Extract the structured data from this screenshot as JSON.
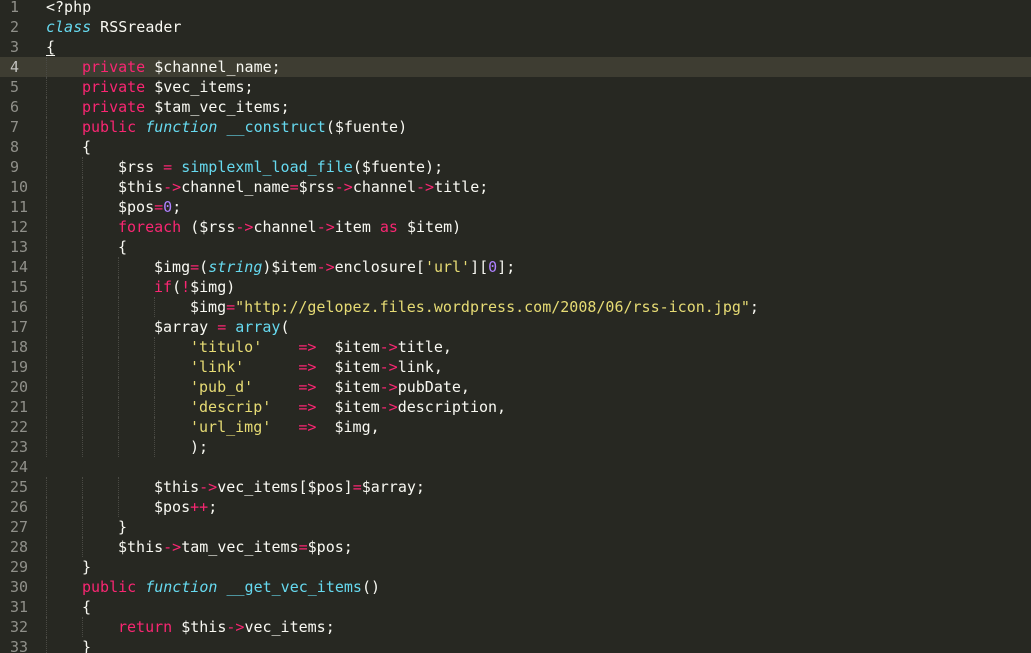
{
  "editor": {
    "colors": {
      "background": "#272822",
      "current_line": "#3e3d32",
      "keyword": "#f92672",
      "storage": "#66d9ef",
      "string": "#e6db74",
      "number": "#ae81ff",
      "plain": "#f8f8f2",
      "gutter_text": "#90908a"
    },
    "current_line_number": 4,
    "lines": [
      {
        "n": "1",
        "indent": 0,
        "tokens": [
          [
            "p",
            "<?php"
          ]
        ]
      },
      {
        "n": "2",
        "indent": 0,
        "tokens": [
          [
            "s",
            "class"
          ],
          [
            "p",
            " RSSreader"
          ]
        ]
      },
      {
        "n": "3",
        "indent": 0,
        "tokens": [
          [
            "u",
            "{"
          ]
        ]
      },
      {
        "n": "4",
        "indent": 1,
        "tokens": [
          [
            "k",
            "private"
          ],
          [
            "p",
            " $channel_name;"
          ]
        ]
      },
      {
        "n": "5",
        "indent": 1,
        "tokens": [
          [
            "k",
            "private"
          ],
          [
            "p",
            " $vec_items;"
          ]
        ]
      },
      {
        "n": "6",
        "indent": 1,
        "tokens": [
          [
            "k",
            "private"
          ],
          [
            "p",
            " $tam_vec_items;"
          ]
        ]
      },
      {
        "n": "7",
        "indent": 1,
        "tokens": [
          [
            "k",
            "public"
          ],
          [
            "p",
            " "
          ],
          [
            "s",
            "function"
          ],
          [
            "p",
            " "
          ],
          [
            "f",
            "__construct"
          ],
          [
            "p",
            "($fuente)"
          ]
        ]
      },
      {
        "n": "8",
        "indent": 1,
        "tokens": [
          [
            "p",
            "{"
          ]
        ]
      },
      {
        "n": "9",
        "indent": 2,
        "tokens": [
          [
            "p",
            "$rss "
          ],
          [
            "o",
            "="
          ],
          [
            "p",
            " "
          ],
          [
            "f",
            "simplexml_load_file"
          ],
          [
            "p",
            "($fuente);"
          ]
        ]
      },
      {
        "n": "10",
        "indent": 2,
        "tokens": [
          [
            "p",
            "$this"
          ],
          [
            "o",
            "->"
          ],
          [
            "p",
            "channel_name"
          ],
          [
            "o",
            "="
          ],
          [
            "p",
            "$rss"
          ],
          [
            "o",
            "->"
          ],
          [
            "p",
            "channel"
          ],
          [
            "o",
            "->"
          ],
          [
            "p",
            "title;"
          ]
        ]
      },
      {
        "n": "11",
        "indent": 2,
        "tokens": [
          [
            "p",
            "$pos"
          ],
          [
            "o",
            "="
          ],
          [
            "n",
            "0"
          ],
          [
            "p",
            ";"
          ]
        ]
      },
      {
        "n": "12",
        "indent": 2,
        "tokens": [
          [
            "k",
            "foreach"
          ],
          [
            "p",
            " ($rss"
          ],
          [
            "o",
            "->"
          ],
          [
            "p",
            "channel"
          ],
          [
            "o",
            "->"
          ],
          [
            "p",
            "item "
          ],
          [
            "k",
            "as"
          ],
          [
            "p",
            " $item)"
          ]
        ]
      },
      {
        "n": "13",
        "indent": 2,
        "tokens": [
          [
            "p",
            "{"
          ]
        ]
      },
      {
        "n": "14",
        "indent": 3,
        "tokens": [
          [
            "p",
            "$img"
          ],
          [
            "o",
            "="
          ],
          [
            "p",
            "("
          ],
          [
            "s",
            "string"
          ],
          [
            "p",
            ")$item"
          ],
          [
            "o",
            "->"
          ],
          [
            "p",
            "enclosure["
          ],
          [
            "q",
            "'url'"
          ],
          [
            "p",
            "]["
          ],
          [
            "n",
            "0"
          ],
          [
            "p",
            "];"
          ]
        ]
      },
      {
        "n": "15",
        "indent": 3,
        "tokens": [
          [
            "k",
            "if"
          ],
          [
            "p",
            "("
          ],
          [
            "o",
            "!"
          ],
          [
            "p",
            "$img)"
          ]
        ]
      },
      {
        "n": "16",
        "indent": 4,
        "tokens": [
          [
            "p",
            "$img"
          ],
          [
            "o",
            "="
          ],
          [
            "q",
            "\"http://gelopez.files.wordpress.com/2008/06/rss-icon.jpg\""
          ],
          [
            "p",
            ";"
          ]
        ]
      },
      {
        "n": "17",
        "indent": 3,
        "tokens": [
          [
            "p",
            "$array "
          ],
          [
            "o",
            "="
          ],
          [
            "p",
            " "
          ],
          [
            "f",
            "array"
          ],
          [
            "p",
            "("
          ]
        ]
      },
      {
        "n": "18",
        "indent": 4,
        "tokens": [
          [
            "q",
            "'titulo'"
          ],
          [
            "p",
            "    "
          ],
          [
            "o",
            "=>"
          ],
          [
            "p",
            "  $item"
          ],
          [
            "o",
            "->"
          ],
          [
            "p",
            "title,"
          ]
        ]
      },
      {
        "n": "19",
        "indent": 4,
        "tokens": [
          [
            "q",
            "'link'"
          ],
          [
            "p",
            "      "
          ],
          [
            "o",
            "=>"
          ],
          [
            "p",
            "  $item"
          ],
          [
            "o",
            "->"
          ],
          [
            "p",
            "link,"
          ]
        ]
      },
      {
        "n": "20",
        "indent": 4,
        "tokens": [
          [
            "q",
            "'pub_d'"
          ],
          [
            "p",
            "     "
          ],
          [
            "o",
            "=>"
          ],
          [
            "p",
            "  $item"
          ],
          [
            "o",
            "->"
          ],
          [
            "p",
            "pubDate,"
          ]
        ]
      },
      {
        "n": "21",
        "indent": 4,
        "tokens": [
          [
            "q",
            "'descrip'"
          ],
          [
            "p",
            "   "
          ],
          [
            "o",
            "=>"
          ],
          [
            "p",
            "  $item"
          ],
          [
            "o",
            "->"
          ],
          [
            "p",
            "description,"
          ]
        ]
      },
      {
        "n": "22",
        "indent": 4,
        "tokens": [
          [
            "q",
            "'url_img'"
          ],
          [
            "p",
            "   "
          ],
          [
            "o",
            "=>"
          ],
          [
            "p",
            "  $img,"
          ]
        ]
      },
      {
        "n": "23",
        "indent": 4,
        "tokens": [
          [
            "p",
            ");"
          ]
        ]
      },
      {
        "n": "24",
        "indent": 0,
        "tokens": []
      },
      {
        "n": "25",
        "indent": 3,
        "tokens": [
          [
            "p",
            "$this"
          ],
          [
            "o",
            "->"
          ],
          [
            "p",
            "vec_items[$pos]"
          ],
          [
            "o",
            "="
          ],
          [
            "p",
            "$array;"
          ]
        ]
      },
      {
        "n": "26",
        "indent": 3,
        "tokens": [
          [
            "p",
            "$pos"
          ],
          [
            "o",
            "++"
          ],
          [
            "p",
            ";"
          ]
        ]
      },
      {
        "n": "27",
        "indent": 2,
        "tokens": [
          [
            "p",
            "}"
          ]
        ]
      },
      {
        "n": "28",
        "indent": 2,
        "tokens": [
          [
            "p",
            "$this"
          ],
          [
            "o",
            "->"
          ],
          [
            "p",
            "tam_vec_items"
          ],
          [
            "o",
            "="
          ],
          [
            "p",
            "$pos;"
          ]
        ]
      },
      {
        "n": "29",
        "indent": 1,
        "tokens": [
          [
            "p",
            "}"
          ]
        ]
      },
      {
        "n": "30",
        "indent": 1,
        "tokens": [
          [
            "k",
            "public"
          ],
          [
            "p",
            " "
          ],
          [
            "s",
            "function"
          ],
          [
            "p",
            " "
          ],
          [
            "f",
            "__get_vec_items"
          ],
          [
            "p",
            "()"
          ]
        ]
      },
      {
        "n": "31",
        "indent": 1,
        "tokens": [
          [
            "p",
            "{"
          ]
        ]
      },
      {
        "n": "32",
        "indent": 2,
        "tokens": [
          [
            "k",
            "return"
          ],
          [
            "p",
            " $this"
          ],
          [
            "o",
            "->"
          ],
          [
            "p",
            "vec_items;"
          ]
        ]
      },
      {
        "n": "33",
        "indent": 1,
        "tokens": [
          [
            "ul",
            "}"
          ]
        ]
      }
    ]
  }
}
